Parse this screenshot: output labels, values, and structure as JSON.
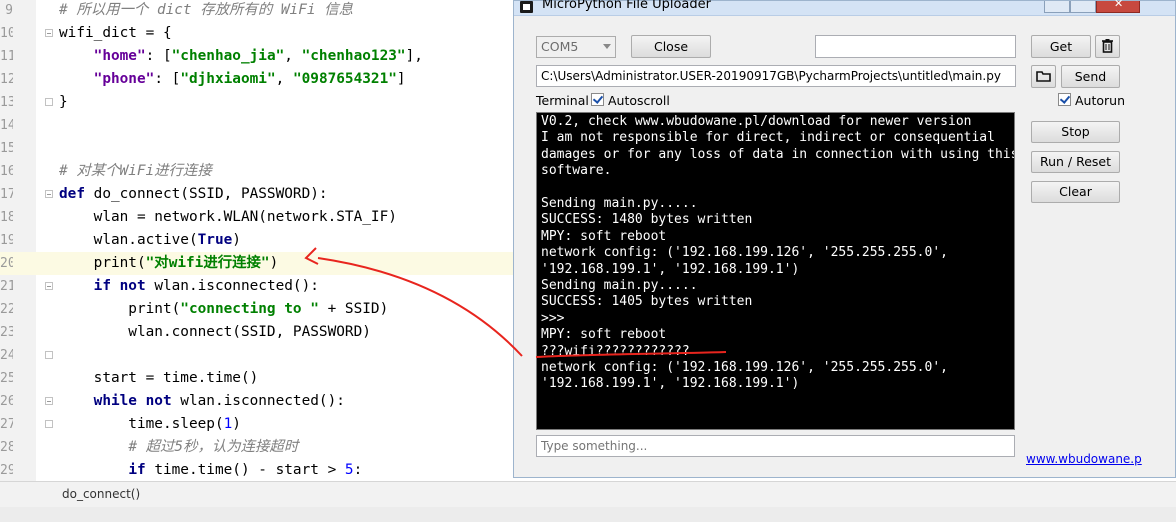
{
  "editor": {
    "lines": [
      {
        "num": "9",
        "tokens": [
          {
            "t": "cmt",
            "v": "# 所以用一个 dict 存放所有的 WiFi 信息"
          }
        ]
      },
      {
        "num": "10",
        "tokens": [
          {
            "t": "",
            "v": "wifi_dict = {"
          }
        ]
      },
      {
        "num": "11",
        "tokens": [
          {
            "t": "",
            "v": "    "
          },
          {
            "t": "key",
            "v": "\"home\""
          },
          {
            "t": "",
            "v": ": ["
          },
          {
            "t": "str",
            "v": "\"chenhao_jia\""
          },
          {
            "t": "",
            "v": ", "
          },
          {
            "t": "str",
            "v": "\"chenhao123\""
          },
          {
            "t": "",
            "v": "],"
          }
        ]
      },
      {
        "num": "12",
        "tokens": [
          {
            "t": "",
            "v": "    "
          },
          {
            "t": "key",
            "v": "\"phone\""
          },
          {
            "t": "",
            "v": ": ["
          },
          {
            "t": "str",
            "v": "\"djhxiaomi\""
          },
          {
            "t": "",
            "v": ", "
          },
          {
            "t": "str",
            "v": "\"0987654321\""
          },
          {
            "t": "",
            "v": "]"
          }
        ]
      },
      {
        "num": "13",
        "tokens": [
          {
            "t": "",
            "v": "}"
          }
        ]
      },
      {
        "num": "14",
        "tokens": []
      },
      {
        "num": "15",
        "tokens": []
      },
      {
        "num": "16",
        "tokens": [
          {
            "t": "cmt",
            "v": "# 对某个WiFi进行连接"
          }
        ]
      },
      {
        "num": "17",
        "tokens": [
          {
            "t": "kw",
            "v": "def "
          },
          {
            "t": "",
            "v": "do_connect(SSID, PASSWORD):"
          }
        ]
      },
      {
        "num": "18",
        "tokens": [
          {
            "t": "",
            "v": "    wlan = network.WLAN(network.STA_IF)"
          }
        ]
      },
      {
        "num": "19",
        "tokens": [
          {
            "t": "",
            "v": "    wlan.active("
          },
          {
            "t": "kw",
            "v": "True"
          },
          {
            "t": "",
            "v": ")"
          }
        ]
      },
      {
        "num": "20",
        "tokens": [
          {
            "t": "",
            "v": "    print("
          },
          {
            "t": "str",
            "v": "\"对wifi进行连接\""
          },
          {
            "t": "",
            "v": ")"
          }
        ]
      },
      {
        "num": "21",
        "tokens": [
          {
            "t": "",
            "v": "    "
          },
          {
            "t": "kw",
            "v": "if not "
          },
          {
            "t": "",
            "v": "wlan.isconnected():"
          }
        ]
      },
      {
        "num": "22",
        "tokens": [
          {
            "t": "",
            "v": "        print("
          },
          {
            "t": "str",
            "v": "\"connecting to \""
          },
          {
            "t": "",
            "v": " + SSID)"
          }
        ]
      },
      {
        "num": "23",
        "tokens": [
          {
            "t": "",
            "v": "        wlan.connect(SSID, PASSWORD)"
          }
        ]
      },
      {
        "num": "24",
        "tokens": []
      },
      {
        "num": "25",
        "tokens": [
          {
            "t": "",
            "v": "    start = time.time()"
          }
        ]
      },
      {
        "num": "26",
        "tokens": [
          {
            "t": "",
            "v": "    "
          },
          {
            "t": "kw",
            "v": "while not "
          },
          {
            "t": "",
            "v": "wlan.isconnected():"
          }
        ]
      },
      {
        "num": "27",
        "tokens": [
          {
            "t": "",
            "v": "        time.sleep("
          },
          {
            "t": "num",
            "v": "1"
          },
          {
            "t": "",
            "v": ")"
          }
        ]
      },
      {
        "num": "28",
        "tokens": [
          {
            "t": "",
            "v": "        "
          },
          {
            "t": "cmt",
            "v": "# 超过5秒，认为连接超时"
          }
        ]
      },
      {
        "num": "29",
        "tokens": [
          {
            "t": "",
            "v": "        "
          },
          {
            "t": "kw",
            "v": "if "
          },
          {
            "t": "",
            "v": "time.time() - start > "
          },
          {
            "t": "num",
            "v": "5"
          },
          {
            "t": "",
            "v": ":"
          }
        ]
      }
    ],
    "breadcrumb": "do_connect()"
  },
  "uploader": {
    "title": "MicroPython File Uploader",
    "port": "COM5",
    "close_label": "Close",
    "get_label": "Get",
    "send_label": "Send",
    "file_path": "C:\\Users\\Administrator.USER-20190917GB\\PycharmProjects\\untitled\\main.py",
    "terminal_label": "Terminal",
    "autoscroll_label": "Autoscroll",
    "autorun_label": "Autorun",
    "stop_label": "Stop",
    "run_reset_label": "Run / Reset",
    "clear_label": "Clear",
    "input_placeholder": "Type something...",
    "link": "www.wbudowane.p",
    "terminal_lines": [
      "V0.2, check www.wbudowane.pl/download for newer version",
      "I am not responsible for direct, indirect or consequential",
      "damages or for any loss of data in connection with using this",
      "software.",
      "",
      "Sending main.py.....",
      "SUCCESS: 1480 bytes written",
      "MPY: soft reboot",
      "network config: ('192.168.199.126', '255.255.255.0',",
      "'192.168.199.1', '192.168.199.1')",
      "Sending main.py.....",
      "SUCCESS: 1405 bytes written",
      ">>>",
      "MPY: soft reboot",
      "???wifi????????????",
      "network config: ('192.168.199.126', '255.255.255.0',",
      "'192.168.199.1', '192.168.199.1')"
    ]
  },
  "annotation_color": "#e8251e"
}
